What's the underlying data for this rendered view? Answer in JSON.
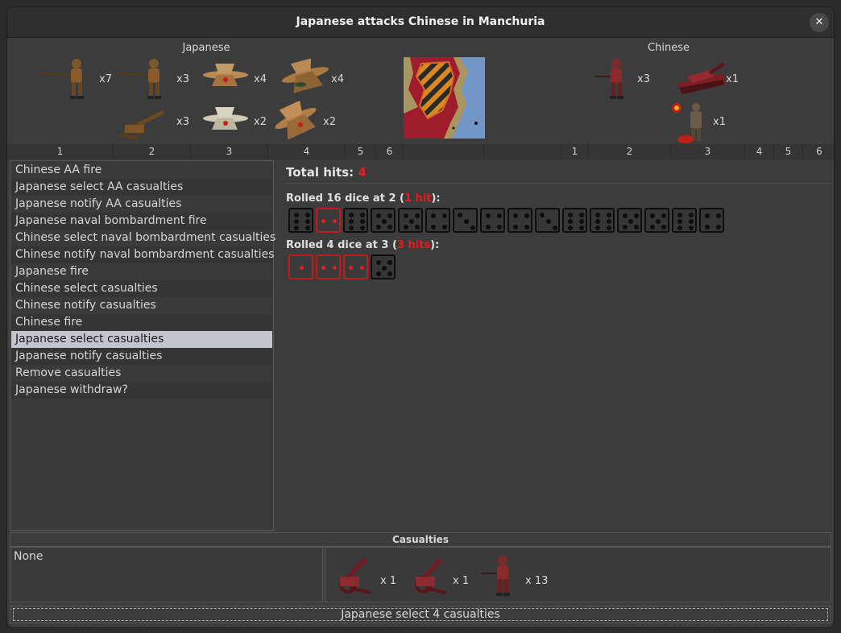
{
  "window": {
    "title": "Japanese attacks Chinese in Manchuria",
    "close_label": "✕"
  },
  "attacker": {
    "label": "Japanese",
    "units": [
      {
        "name": "infantry",
        "count": "x7"
      },
      {
        "name": "infantry",
        "count": "x3"
      },
      {
        "name": "fighter",
        "count": "x4"
      },
      {
        "name": "bomber",
        "count": "x4"
      },
      {
        "name": "artillery",
        "count": "x3"
      },
      {
        "name": "fighter",
        "count": "x2"
      },
      {
        "name": "tactical-bomber",
        "count": "x2"
      }
    ]
  },
  "defender": {
    "label": "Chinese",
    "units": [
      {
        "name": "infantry",
        "count": "x3"
      },
      {
        "name": "tank",
        "count": "x1"
      },
      {
        "name": "officer",
        "count": "x1"
      }
    ]
  },
  "dice_strip": {
    "attacker": [
      "1",
      "2",
      "3",
      "4",
      "5",
      "6"
    ],
    "defender": [
      "1",
      "2",
      "3",
      "4",
      "5",
      "6"
    ]
  },
  "steps": [
    "Chinese AA fire",
    "Japanese select AA casualties",
    "Japanese notify AA casualties",
    "Japanese naval bombardment fire",
    "Chinese select naval bombardment casualties",
    "Chinese notify naval bombardment casualties",
    "Japanese fire",
    "Chinese select casualties",
    "Chinese notify casualties",
    "Chinese fire",
    "Japanese select casualties",
    "Japanese notify casualties",
    "Remove casualties",
    "Japanese withdraw?"
  ],
  "selected_step": 10,
  "results": {
    "total_hits_label": "Total hits: ",
    "total_hits_value": "4",
    "roll1": {
      "prefix": "Rolled 16 dice at 2 (",
      "hits": "1 hit",
      "suffix": "):"
    },
    "roll1_dice": [
      6,
      2,
      6,
      5,
      5,
      4,
      3,
      4,
      4,
      3,
      6,
      6,
      5,
      5,
      6,
      4
    ],
    "roll2": {
      "prefix": "Rolled 4 dice at 3 (",
      "hits": "3 hits",
      "suffix": "):"
    },
    "roll2_dice": [
      1,
      2,
      2,
      5
    ],
    "hit_threshold_1": 2,
    "hit_threshold_2": 3
  },
  "casualties": {
    "header": "Casualties",
    "left_text": "None",
    "units": [
      {
        "name": "artillery",
        "count": "x 1"
      },
      {
        "name": "artillery",
        "count": "x 1"
      },
      {
        "name": "infantry",
        "count": "x 13"
      }
    ]
  },
  "status": {
    "text": "Japanese select 4 casualties"
  },
  "colors": {
    "hit": "#e51c1c",
    "japanese_unit": "#8a5a2b",
    "chinese_unit": "#8b2a2a",
    "selection": "#c4c4cf"
  }
}
